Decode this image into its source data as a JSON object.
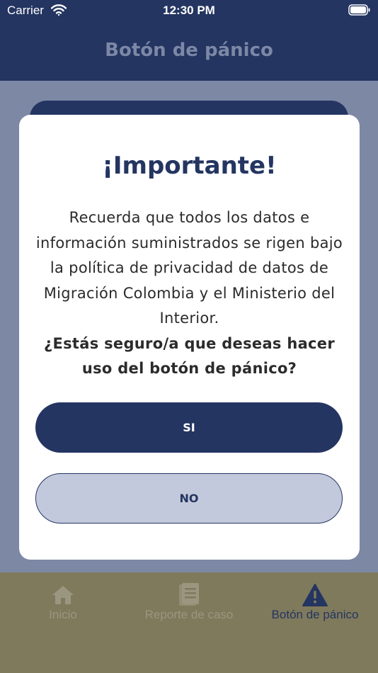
{
  "status_bar": {
    "carrier": "Carrier",
    "time": "12:30 PM"
  },
  "header": {
    "title": "Botón de pánico"
  },
  "tabs": [
    {
      "label": "Inicio",
      "icon": "home-icon"
    },
    {
      "label": "Reporte de caso",
      "icon": "document-icon"
    },
    {
      "label": "Botón de pánico",
      "icon": "warning-icon",
      "active": true
    }
  ],
  "modal": {
    "title": "¡Importante!",
    "message": "Recuerda que todos los datos e información suministrados se rigen bajo la política de privacidad de datos de Migración Colombia y el Ministerio del Interior.",
    "question": "¿Estás seguro/a que deseas hacer uso del botón de pánico?",
    "confirm_label": "SI",
    "cancel_label": "NO"
  },
  "colors": {
    "primary": "#243561",
    "overlay_tint": "#7d88a5",
    "secondary_button": "#c3c9dc",
    "tab_bar": "#7f7a5c"
  }
}
